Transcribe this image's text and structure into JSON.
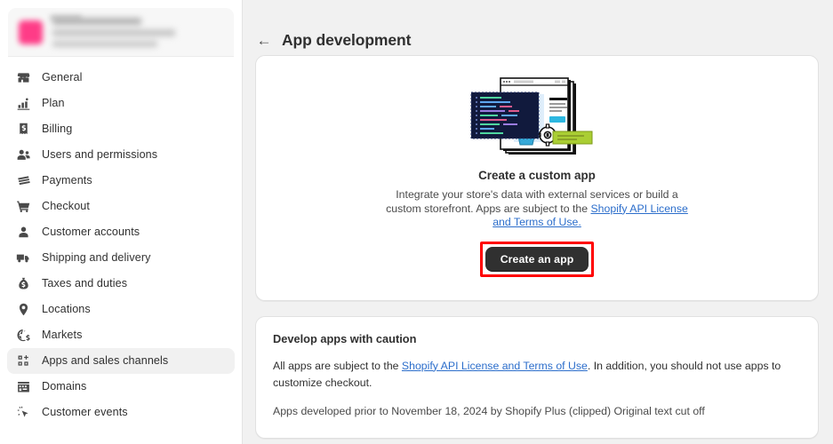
{
  "colors": {
    "page_bg": "#f1f1f1",
    "card_bg": "#ffffff",
    "text": "#303030",
    "subtext": "#4a4a4a",
    "link": "#2c6ecb",
    "button_bg": "#303030",
    "highlight_box": "#ff0000",
    "store_logo": "#ff2d7e",
    "active_nav_bg": "#f1f1f1"
  },
  "sidebar": {
    "store_name_redacted": "",
    "store_sub_redacted": "",
    "items": [
      {
        "label": "General",
        "icon": "store-icon",
        "active": false
      },
      {
        "label": "Plan",
        "icon": "chart-icon",
        "active": false
      },
      {
        "label": "Billing",
        "icon": "bill-icon",
        "active": false
      },
      {
        "label": "Users and permissions",
        "icon": "users-icon",
        "active": false
      },
      {
        "label": "Payments",
        "icon": "credit-card-icon",
        "active": false
      },
      {
        "label": "Checkout",
        "icon": "cart-icon",
        "active": false
      },
      {
        "label": "Customer accounts",
        "icon": "person-icon",
        "active": false
      },
      {
        "label": "Shipping and delivery",
        "icon": "truck-icon",
        "active": false
      },
      {
        "label": "Taxes and duties",
        "icon": "money-bag-icon",
        "active": false
      },
      {
        "label": "Locations",
        "icon": "location-pin-icon",
        "active": false
      },
      {
        "label": "Markets",
        "icon": "globe-dollar-icon",
        "active": false
      },
      {
        "label": "Apps and sales channels",
        "icon": "grid-plus-icon",
        "active": true
      },
      {
        "label": "Domains",
        "icon": "domain-icon",
        "active": false
      },
      {
        "label": "Customer events",
        "icon": "cursor-click-icon",
        "active": false
      }
    ]
  },
  "header": {
    "back_icon": "←",
    "title": "App development"
  },
  "hero_card": {
    "illustration": "custom-app-illustration",
    "title": "Create a custom app",
    "body_part1": "Integrate your store's data with external services or build a custom storefront. Apps are subject to the ",
    "body_link": "Shopify API License and Terms of Use.",
    "button_label": "Create an app",
    "highlighted": true
  },
  "caution_card": {
    "title": "Develop apps with caution",
    "body_part1": "All apps are subject to the ",
    "body_link": "Shopify API License and Terms of Use",
    "body_part2": ". In addition, you should not use apps to customize checkout.",
    "body_clipped": "Apps developed prior to November 18, 2024 by Shopify Plus (clipped) Original text cut off"
  }
}
